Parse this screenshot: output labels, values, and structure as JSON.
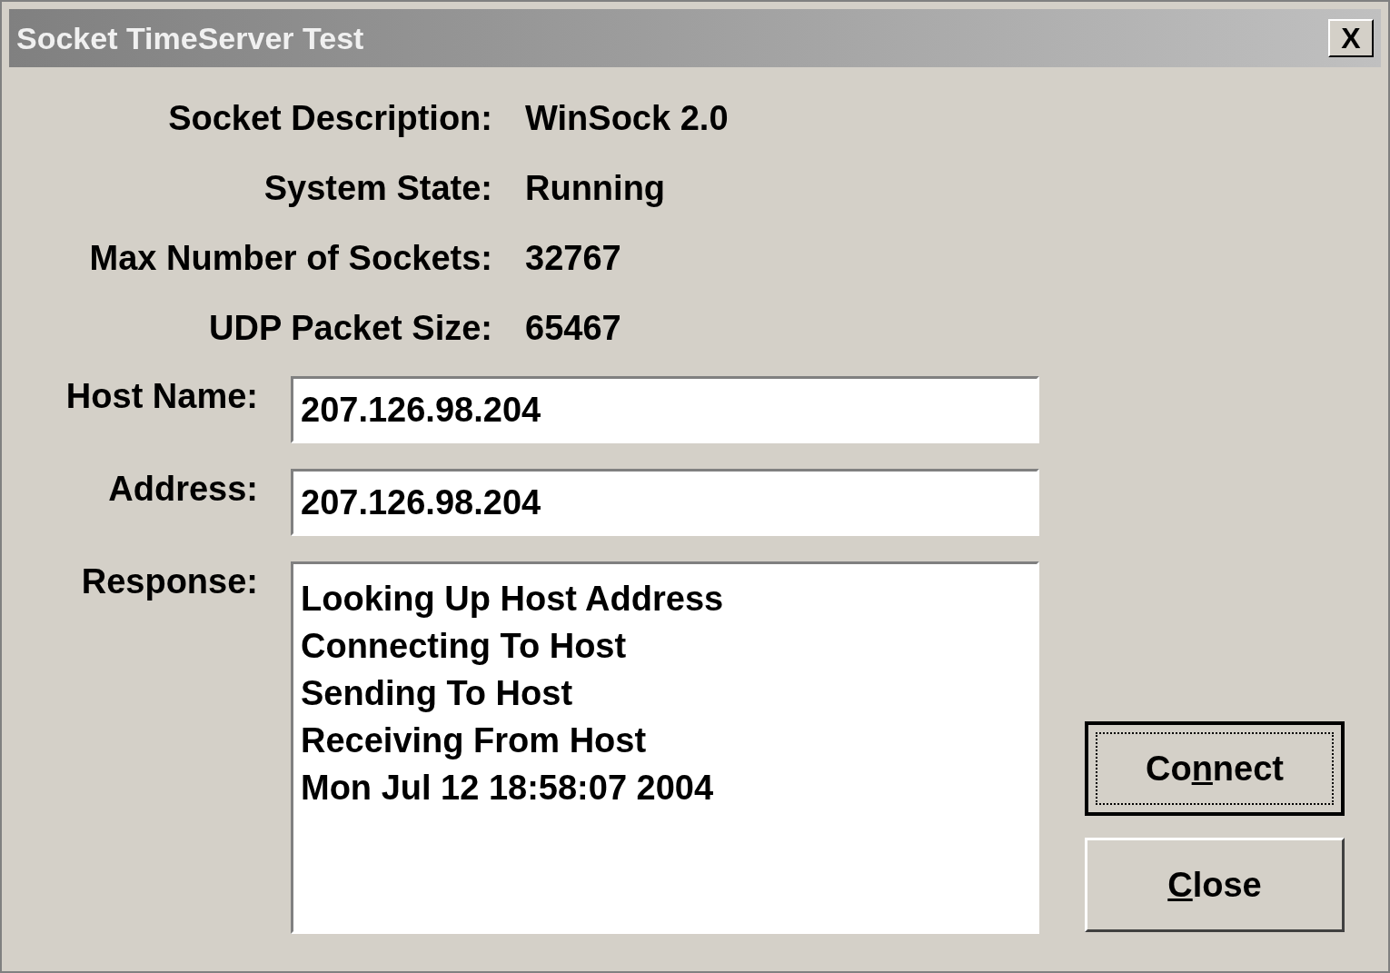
{
  "window": {
    "title": "Socket TimeServer Test",
    "close_label": "X"
  },
  "info": [
    {
      "label": "Socket Description:",
      "value": "WinSock 2.0"
    },
    {
      "label": "System State:",
      "value": "Running"
    },
    {
      "label": "Max Number of Sockets:",
      "value": "32767"
    },
    {
      "label": "UDP Packet Size:",
      "value": "65467"
    }
  ],
  "fields": [
    {
      "label": "Host Name:",
      "value": "207.126.98.204"
    },
    {
      "label": "Address:",
      "value": "207.126.98.204"
    }
  ],
  "response": {
    "label": "Response:",
    "lines": [
      "Looking Up Host Address",
      "Connecting To Host",
      "Sending To Host",
      "Receiving From Host",
      "Mon Jul 12 18:58:07 2004"
    ]
  },
  "buttons": [
    {
      "before": "Co",
      "mnemonic": "n",
      "after": "nect",
      "focused": true
    },
    {
      "mnemonic": "C",
      "after": "lose",
      "focused": false
    }
  ]
}
